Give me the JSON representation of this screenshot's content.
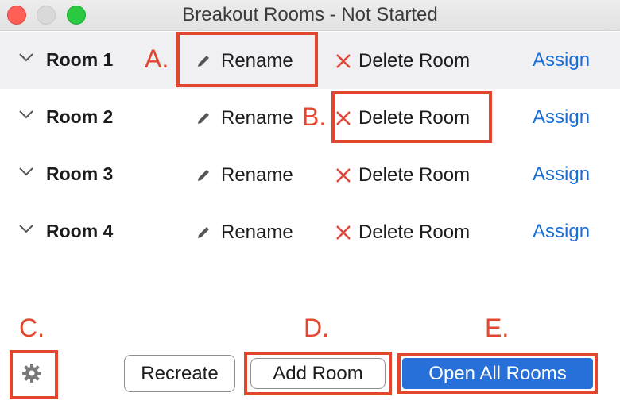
{
  "window": {
    "title": "Breakout Rooms - Not Started"
  },
  "rooms": [
    {
      "name": "Room 1",
      "rename_label": "Rename",
      "delete_label": "Delete Room",
      "assign_label": "Assign"
    },
    {
      "name": "Room 2",
      "rename_label": "Rename",
      "delete_label": "Delete Room",
      "assign_label": "Assign"
    },
    {
      "name": "Room 3",
      "rename_label": "Rename",
      "delete_label": "Delete Room",
      "assign_label": "Assign"
    },
    {
      "name": "Room 4",
      "rename_label": "Rename",
      "delete_label": "Delete Room",
      "assign_label": "Assign"
    }
  ],
  "annotations": {
    "a": "A.",
    "b": "B.",
    "c": "C.",
    "d": "D.",
    "e": "E."
  },
  "footer": {
    "settings_icon": "gear-icon",
    "recreate_label": "Recreate",
    "add_room_label": "Add Room",
    "open_all_label": "Open All Rooms"
  },
  "colors": {
    "annotation": "#e2462f",
    "link": "#1a6ed8",
    "primary_button": "#2870d9",
    "delete_x": "#e0453a"
  }
}
